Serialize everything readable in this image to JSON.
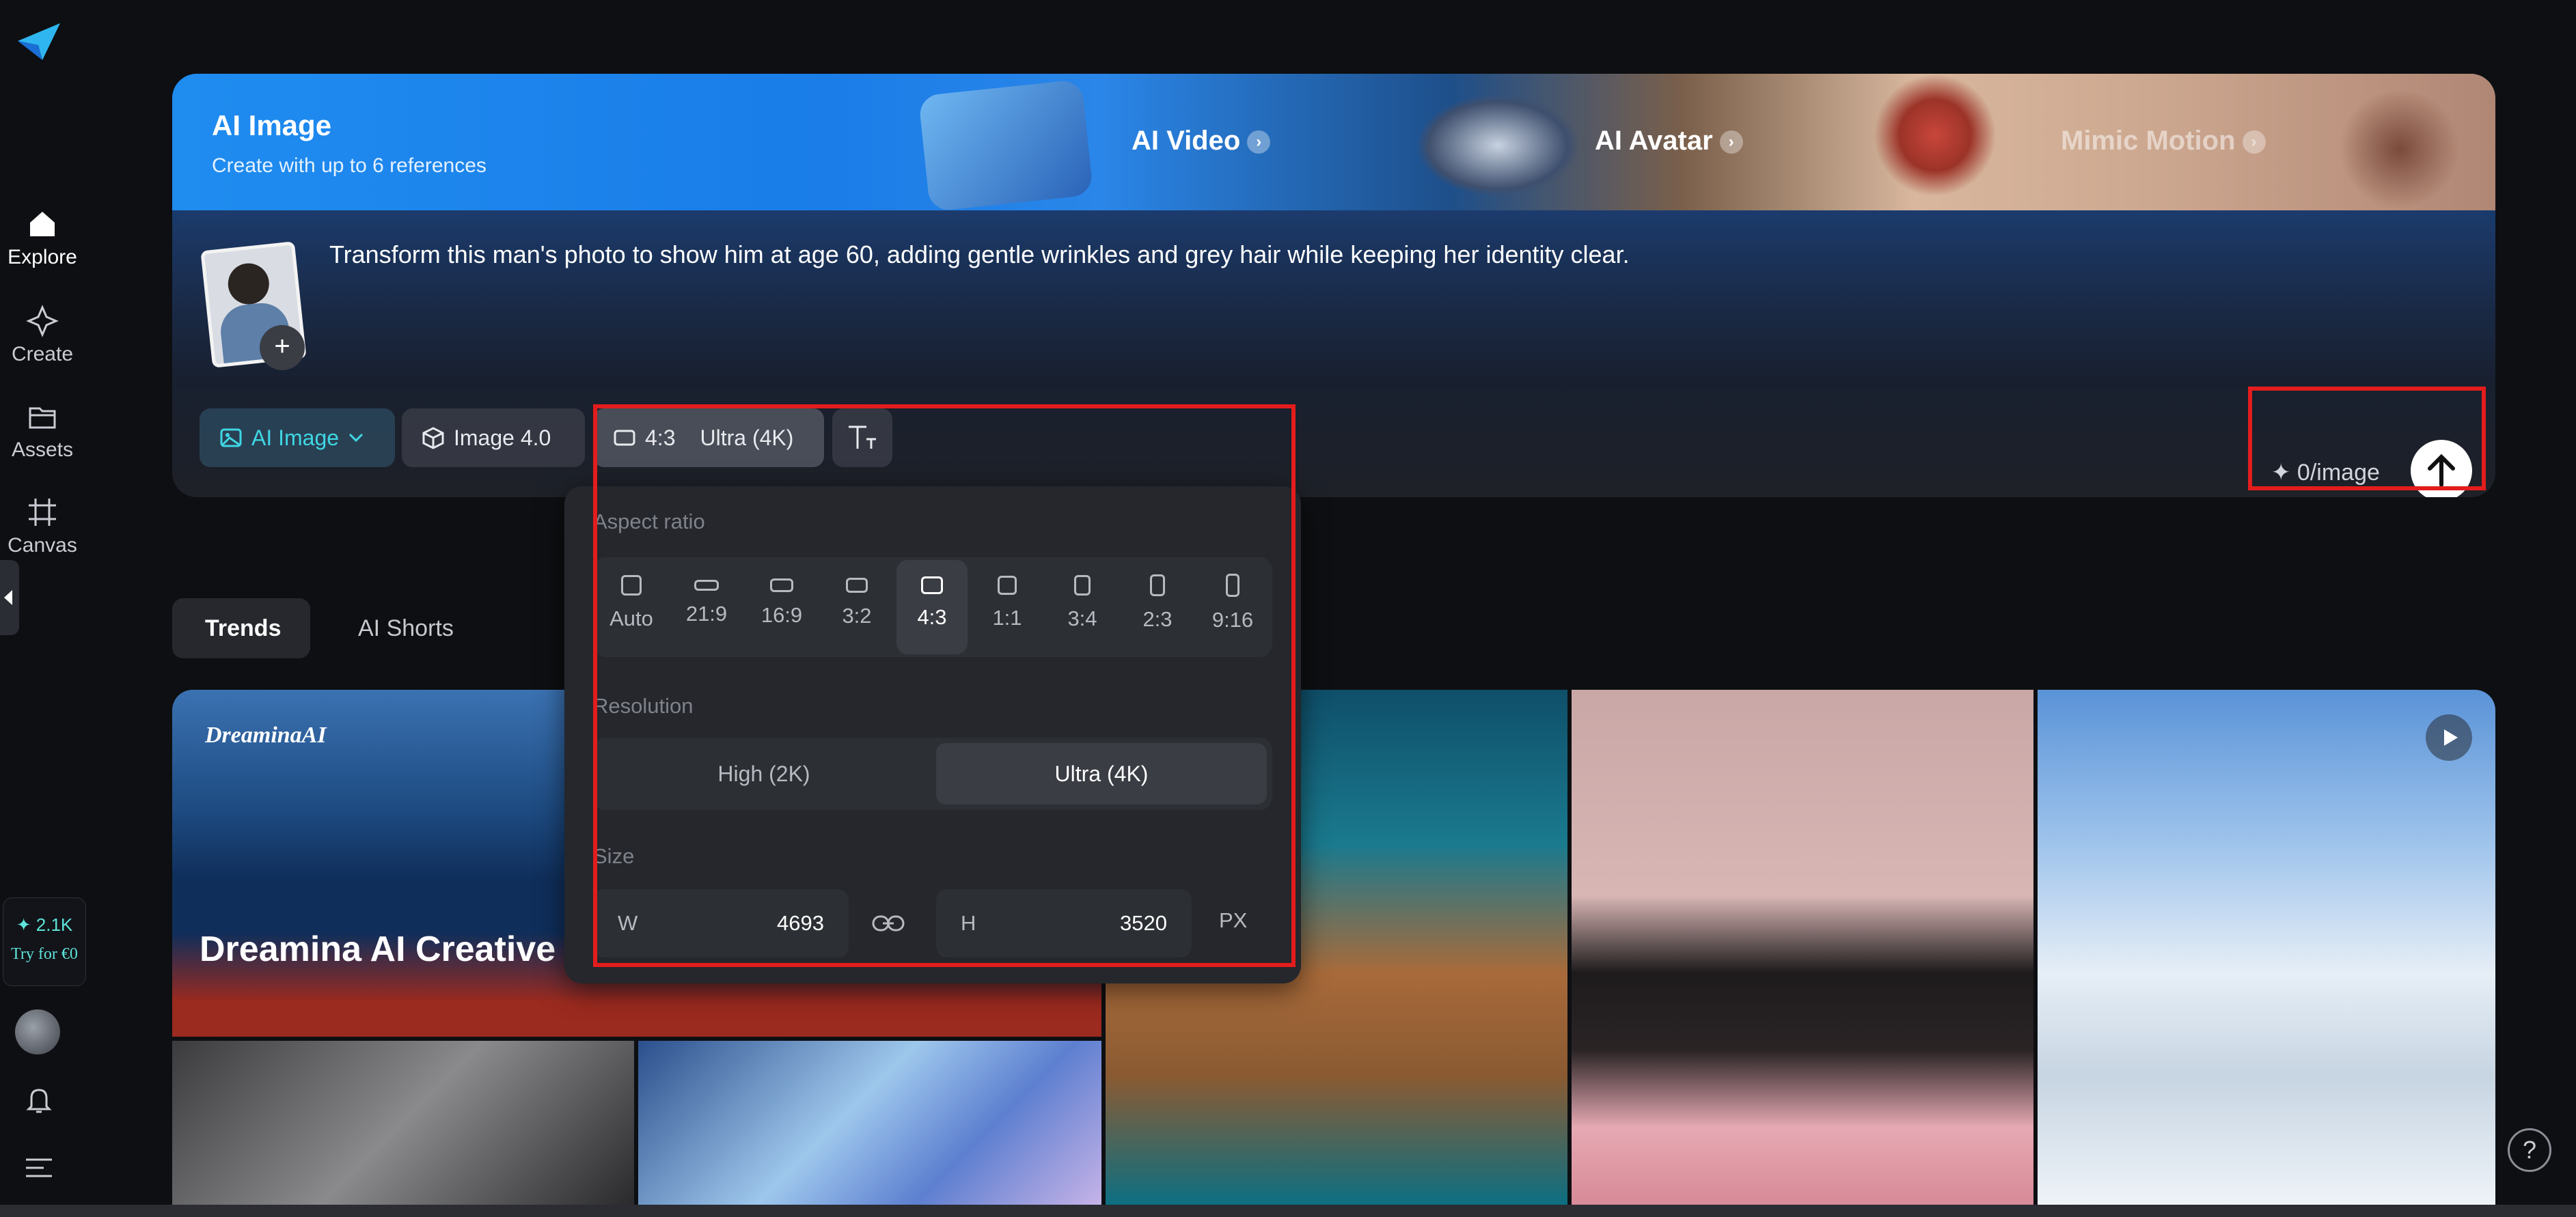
{
  "sidebar": {
    "items": [
      {
        "label": "Explore",
        "icon": "home-icon",
        "active": true
      },
      {
        "label": "Create",
        "icon": "sparkle-icon",
        "active": false
      },
      {
        "label": "Assets",
        "icon": "folder-icon",
        "active": false
      },
      {
        "label": "Canvas",
        "icon": "canvas-icon",
        "active": false
      }
    ],
    "credits_count": "✦ 2.1K",
    "credits_cta": "Try for €0"
  },
  "banner": {
    "title": "AI Image",
    "subtitle": "Create with up to 6 references",
    "promos": [
      "AI Video",
      "AI Avatar",
      "Mimic Motion"
    ]
  },
  "composer": {
    "prompt": "Transform this man's photo to show him at age 60, adding gentle wrinkles and grey hair while keeping her identity clear.",
    "add_reference": "+",
    "mode_label": "AI Image",
    "model_label": "Image 4.0",
    "ratio_label": "4:3",
    "quality_label": "Ultra (4K)",
    "cost_label": "✦ 0/image"
  },
  "popup": {
    "aspect_ratio_title": "Aspect ratio",
    "ratios": [
      "Auto",
      "21:9",
      "16:9",
      "3:2",
      "4:3",
      "1:1",
      "3:4",
      "2:3",
      "9:16"
    ],
    "selected_ratio": "4:3",
    "resolution_title": "Resolution",
    "resolutions": [
      "High (2K)",
      "Ultra (4K)"
    ],
    "selected_resolution": "Ultra (4K)",
    "size_title": "Size",
    "width_label": "W",
    "width_value": "4693",
    "height_label": "H",
    "height_value": "3520",
    "unit": "PX"
  },
  "tabs": [
    "Trends",
    "AI Shorts"
  ],
  "gallery": {
    "feature_logo": "DreaminaAI",
    "feature_title": "Dreamina AI Creative I"
  },
  "colors": {
    "accent": "#3fd6e3",
    "highlight": "#e31d1d",
    "background": "#0e0f12"
  }
}
